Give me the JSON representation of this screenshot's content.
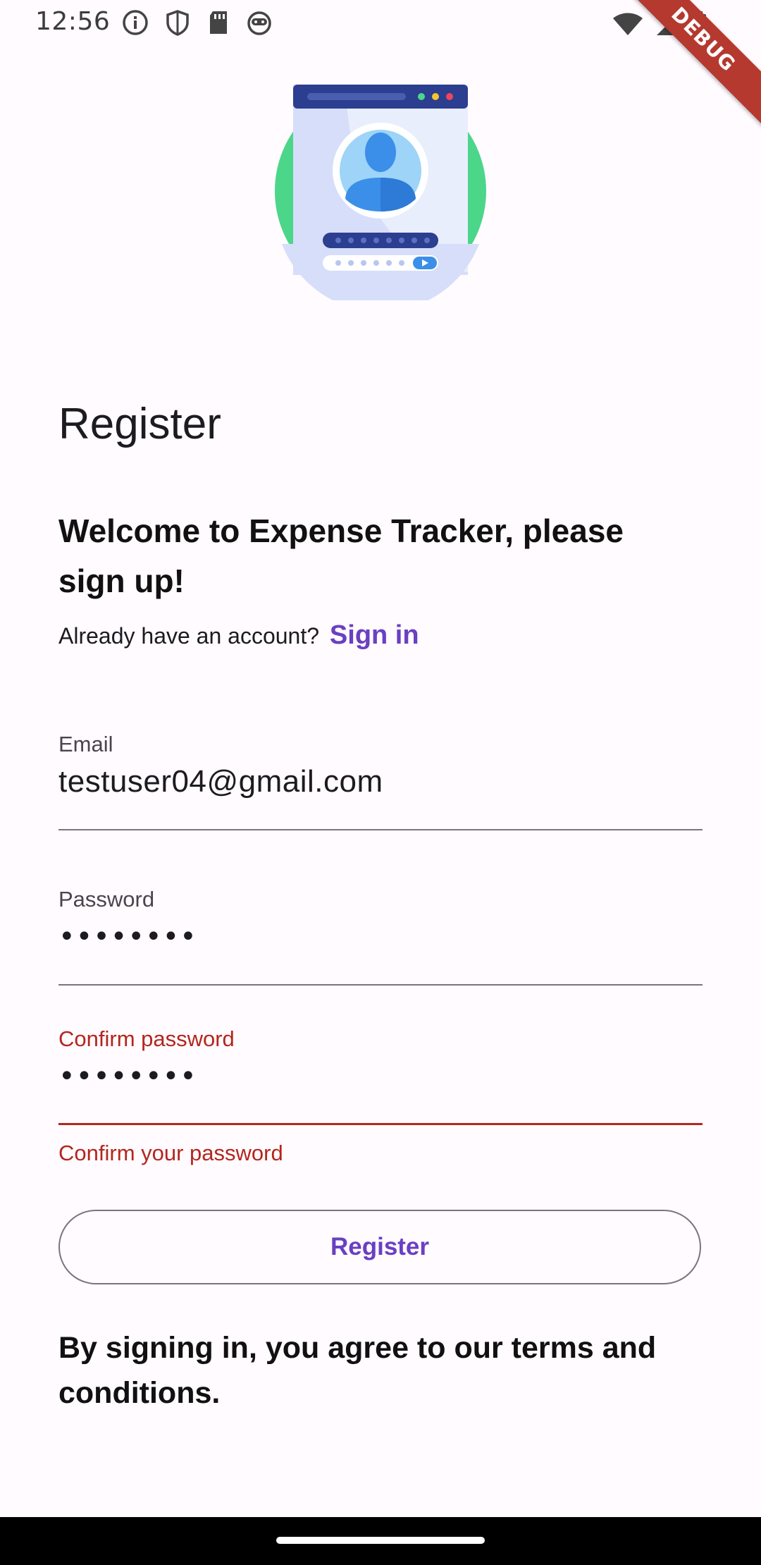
{
  "status_bar": {
    "time": "12:56",
    "left_icons": [
      "info-icon",
      "shield-icon",
      "sd-card-icon",
      "bot-icon"
    ],
    "right_icons": [
      "wifi-icon",
      "signal-icon",
      "battery-icon"
    ]
  },
  "debug_banner": {
    "label": "DEBUG"
  },
  "hero": {
    "icon": "user-profile-illustration"
  },
  "page": {
    "title": "Register"
  },
  "welcome": {
    "text": "Welcome to Expense Tracker, please sign up!"
  },
  "signin": {
    "prompt": "Already have an account?",
    "link_label": "Sign in"
  },
  "form": {
    "email": {
      "label": "Email",
      "value": "testuser04@gmail.com"
    },
    "password": {
      "label": "Password",
      "value": "••••••••"
    },
    "confirm_password": {
      "label": "Confirm password",
      "value": "••••••••",
      "error": "Confirm your password"
    }
  },
  "register_button": {
    "label": "Register"
  },
  "terms": {
    "text": "By signing in, you agree to our terms and conditions."
  },
  "colors": {
    "accent": "#6a3fc2",
    "error": "#b3261e",
    "background": "#fffbfe",
    "hero_green": "#4cd68a",
    "hero_navy": "#2c3e8f"
  }
}
